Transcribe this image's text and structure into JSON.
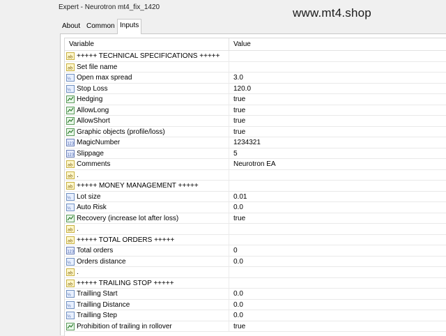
{
  "window": {
    "title": "Expert - Neurotron mt4_fix_1420"
  },
  "watermark": "www.mt4.shop",
  "tabs": [
    {
      "label": "About"
    },
    {
      "label": "Common"
    },
    {
      "label": "Inputs",
      "active": true
    }
  ],
  "table": {
    "columns": {
      "variable": "Variable",
      "value": "Value"
    },
    "rows": [
      {
        "icon": "string",
        "variable": "+++++   TECHNICAL SPECIFICATIONS   +++++",
        "value": ""
      },
      {
        "icon": "string",
        "variable": "Set file name",
        "value": ""
      },
      {
        "icon": "double",
        "variable": "Open max spread",
        "value": "3.0"
      },
      {
        "icon": "double",
        "variable": "Stop Loss",
        "value": "120.0"
      },
      {
        "icon": "bool",
        "variable": "Hedging",
        "value": "true"
      },
      {
        "icon": "bool",
        "variable": "AllowLong",
        "value": "true"
      },
      {
        "icon": "bool",
        "variable": "AllowShort",
        "value": "true"
      },
      {
        "icon": "bool",
        "variable": "Graphic objects (profile/loss)",
        "value": "true"
      },
      {
        "icon": "int",
        "variable": "MagicNumber",
        "value": "1234321"
      },
      {
        "icon": "int",
        "variable": "Slippage",
        "value": "5"
      },
      {
        "icon": "string",
        "variable": "Comments",
        "value": "Neurotron EA"
      },
      {
        "icon": "string",
        "variable": ".",
        "value": ""
      },
      {
        "icon": "string",
        "variable": "+++++   MONEY MANAGEMENT   +++++",
        "value": ""
      },
      {
        "icon": "double",
        "variable": "Lot size",
        "value": "0.01"
      },
      {
        "icon": "double",
        "variable": "Auto Risk",
        "value": "0.0"
      },
      {
        "icon": "bool",
        "variable": "Recovery (increase lot after loss)",
        "value": "true"
      },
      {
        "icon": "string",
        "variable": ".",
        "value": ""
      },
      {
        "icon": "string",
        "variable": "+++++   TOTAL ORDERS   +++++",
        "value": ""
      },
      {
        "icon": "int",
        "variable": "Total orders",
        "value": "0"
      },
      {
        "icon": "double",
        "variable": "Orders distance",
        "value": "0.0"
      },
      {
        "icon": "string",
        "variable": ".",
        "value": ""
      },
      {
        "icon": "string",
        "variable": "+++++   TRAILING STOP   +++++",
        "value": ""
      },
      {
        "icon": "double",
        "variable": "Trailling Start",
        "value": "0.0"
      },
      {
        "icon": "double",
        "variable": "Trailling Distance",
        "value": "0.0"
      },
      {
        "icon": "double",
        "variable": "Trailling Step",
        "value": "0.0"
      },
      {
        "icon": "bool",
        "variable": "Prohibition of trailing in rollover",
        "value": "true"
      }
    ]
  }
}
